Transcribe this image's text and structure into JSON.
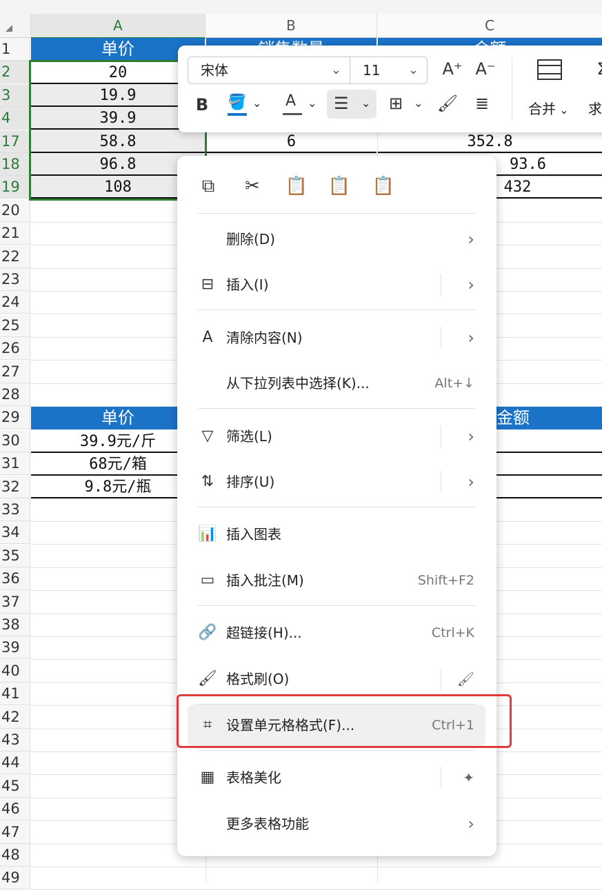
{
  "columns": [
    "A",
    "B",
    "C"
  ],
  "rows": [
    "1",
    "2",
    "3",
    "4",
    "17",
    "18",
    "19",
    "20",
    "21",
    "22",
    "23",
    "24",
    "25",
    "26",
    "27",
    "28",
    "29",
    "30",
    "31",
    "32",
    "33",
    "34",
    "35",
    "36",
    "37",
    "38",
    "39",
    "40",
    "41",
    "42",
    "43",
    "44",
    "45",
    "46",
    "47",
    "48",
    "49"
  ],
  "table1": {
    "header": {
      "a": "单价",
      "b": "销售数量",
      "c": "金额"
    },
    "a_values": [
      "20",
      "19.9",
      "39.9",
      "58.8",
      "96.8",
      "108"
    ],
    "b_value": "6",
    "c_values": [
      "352.8",
      "93.6",
      "432"
    ]
  },
  "table2": {
    "header": {
      "a": "单价",
      "c": "金额"
    },
    "a_values": [
      "39.9元/斤",
      "68元/箱",
      "9.8元/瓶"
    ]
  },
  "toolbar": {
    "font": "宋体",
    "size": "11",
    "grow": "A⁺",
    "shrink": "A⁻",
    "bold": "B",
    "merge": "合并",
    "sum_partial": "求"
  },
  "menu": {
    "quick_icons": [
      "copy-icon",
      "cut-icon",
      "paste-icon",
      "paste-text-icon",
      "paste-special-icon"
    ],
    "items": [
      {
        "label": "删除(D)",
        "shortcut": "",
        "arrow": true,
        "icon": ""
      },
      {
        "label": "插入(I)",
        "shortcut": "",
        "arrow": true,
        "icon": "insert-icon"
      },
      {
        "label": "清除内容(N)",
        "shortcut": "",
        "arrow": true,
        "icon": "clear-icon"
      },
      {
        "label": "从下拉列表中选择(K)...",
        "shortcut": "Alt+↓",
        "arrow": false,
        "icon": ""
      },
      {
        "label": "筛选(L)",
        "shortcut": "",
        "arrow": true,
        "icon": "filter-icon"
      },
      {
        "label": "排序(U)",
        "shortcut": "",
        "arrow": true,
        "icon": "sort-icon"
      },
      {
        "label": "插入图表",
        "shortcut": "",
        "arrow": false,
        "icon": "chart-icon"
      },
      {
        "label": "插入批注(M)",
        "shortcut": "Shift+F2",
        "arrow": false,
        "icon": "comment-icon"
      },
      {
        "label": "超链接(H)...",
        "shortcut": "Ctrl+K",
        "arrow": false,
        "icon": "link-icon"
      },
      {
        "label": "格式刷(O)",
        "shortcut": "",
        "arrow": false,
        "icon": "format-painter-icon"
      },
      {
        "label": "设置单元格格式(F)...",
        "shortcut": "Ctrl+1",
        "arrow": false,
        "icon": "format-cells-icon"
      },
      {
        "label": "表格美化",
        "shortcut": "",
        "arrow": false,
        "icon": "table-beautify-icon"
      },
      {
        "label": "更多表格功能",
        "shortcut": "",
        "arrow": true,
        "icon": ""
      }
    ]
  },
  "colors": {
    "header_blue": "#1b73c8",
    "selection_green": "#2f7d32",
    "highlight_red": "#e23a3a"
  }
}
